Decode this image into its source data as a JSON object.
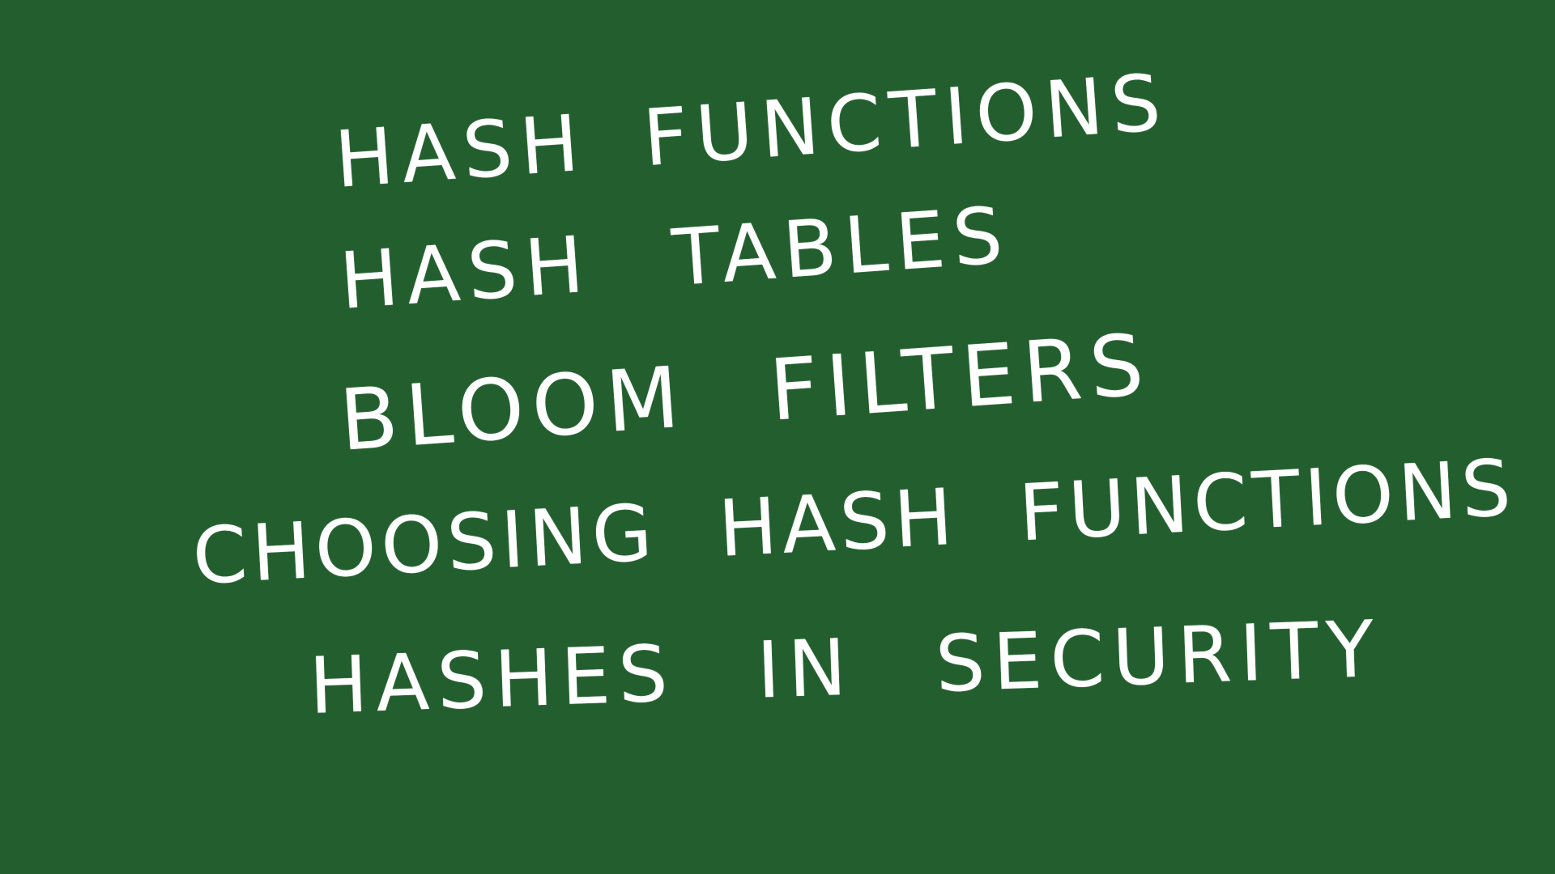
{
  "topics": [
    "HASH FUNCTIONS",
    "HASH TABLES",
    "BLOOM FILTERS",
    "CHOOSING HASH FUNCTIONS",
    "HASHES IN SECURITY"
  ],
  "colors": {
    "background": "#235f2e",
    "chalk": "#ffffff"
  }
}
